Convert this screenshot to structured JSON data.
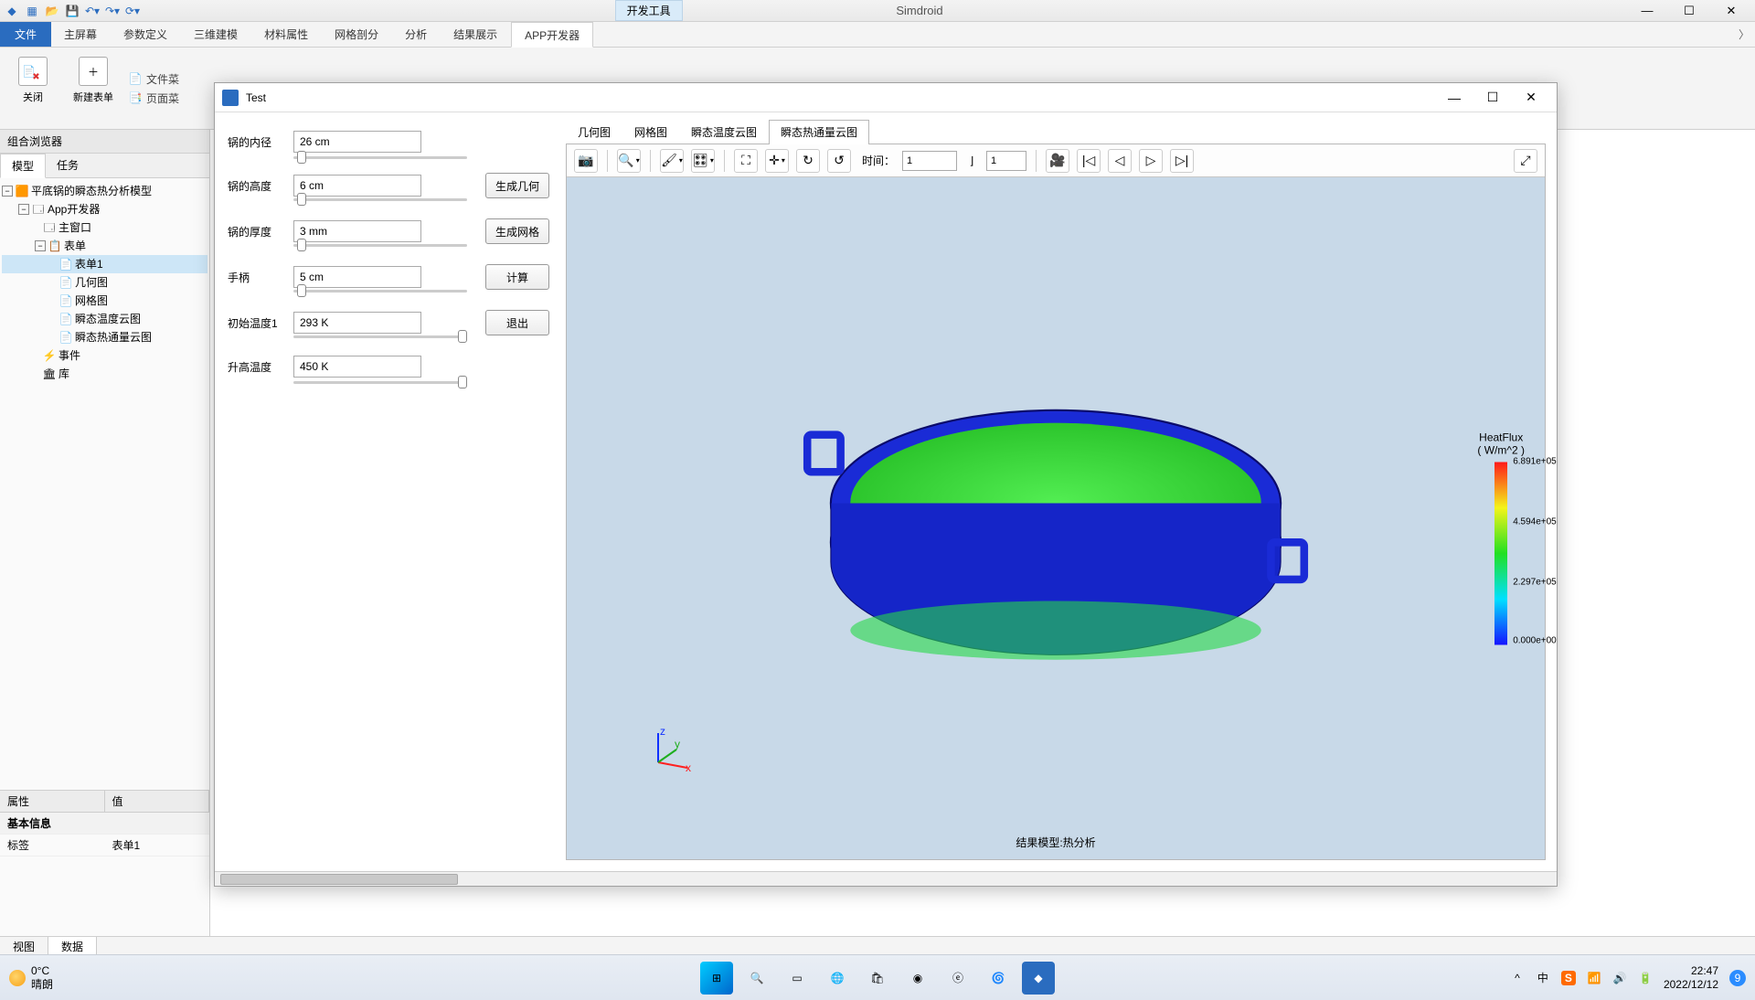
{
  "app_title": "Simdroid",
  "contextual_tab": "开发工具",
  "window_controls": {
    "min": "—",
    "max": "☐",
    "close": "✕"
  },
  "ribbon": {
    "file": "文件",
    "tabs": [
      "主屏幕",
      "参数定义",
      "三维建模",
      "材料属性",
      "网格剖分",
      "分析",
      "结果展示",
      "APP开发器"
    ],
    "active": 7,
    "btn_close": "关闭",
    "btn_new": "新建表单",
    "line1": "文件菜",
    "line2": "页面菜"
  },
  "browser": {
    "title": "组合浏览器",
    "tabs": {
      "model": "模型",
      "tasks": "任务"
    },
    "root": "平底锅的瞬态热分析模型",
    "nodes": {
      "app": "App开发器",
      "main": "主窗口",
      "forms": "表单",
      "form1": "表单1",
      "geom": "几何图",
      "mesh": "网格图",
      "temp": "瞬态温度云图",
      "flux": "瞬态热通量云图",
      "events": "事件",
      "lib": "库"
    }
  },
  "props": {
    "h_attr": "属性",
    "h_val": "值",
    "grp": "基本信息",
    "k_label": "标签",
    "v_label": "表单1"
  },
  "viewdata": {
    "view": "视图",
    "data": "数据"
  },
  "testwin": {
    "title": "Test",
    "params": {
      "diam": {
        "label": "锅的内径",
        "val": "26 cm"
      },
      "height": {
        "label": "锅的高度",
        "val": "6 cm"
      },
      "thick": {
        "label": "锅的厚度",
        "val": "3 mm"
      },
      "handle": {
        "label": "手柄",
        "val": "5 cm"
      },
      "t0": {
        "label": "初始温度1",
        "val": "293 K"
      },
      "thi": {
        "label": "升高温度",
        "val": "450 K"
      }
    },
    "buttons": {
      "gen_geom": "生成几何",
      "gen_mesh": "生成网格",
      "calc": "计算",
      "exit": "退出"
    },
    "tabs": [
      "几何图",
      "网格图",
      "瞬态温度云图",
      "瞬态热通量云图"
    ],
    "time_label": "时间：",
    "time_val": "1",
    "frame_val": "1",
    "legend": {
      "title": "HeatFlux",
      "unit": "( W/m^2 )",
      "max": "6.891e+05",
      "mid1": "4.594e+05",
      "mid2": "2.297e+05",
      "min": "0.000e+00"
    },
    "caption": "结果模型:热分析"
  },
  "taskbar": {
    "temp": "0°C",
    "cond": "晴朗",
    "time": "22:47",
    "date": "2022/12/12",
    "badge": "9"
  }
}
